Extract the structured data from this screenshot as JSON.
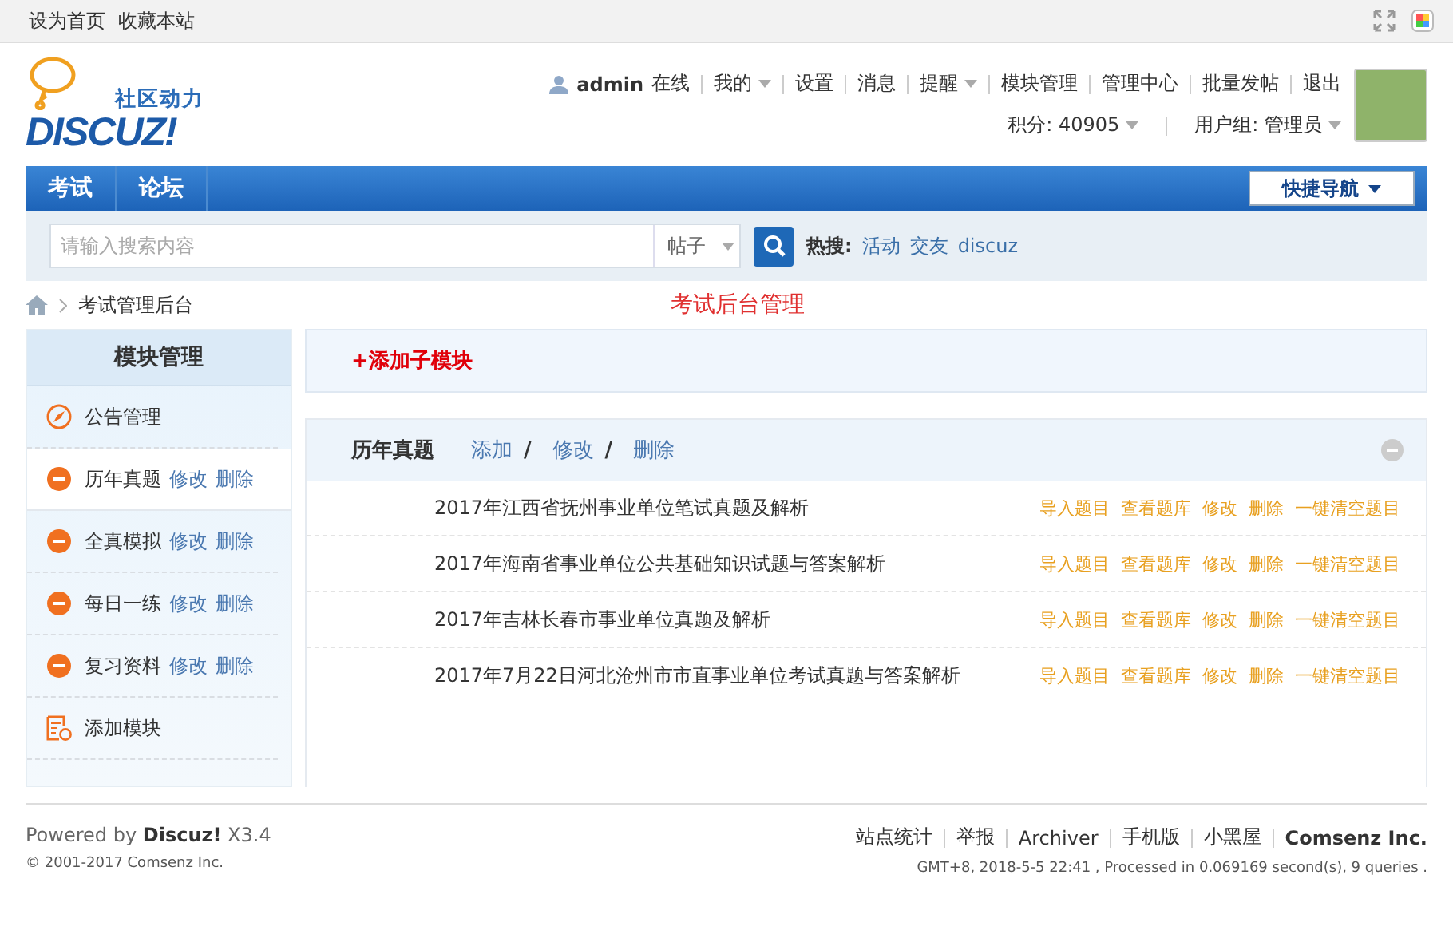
{
  "topbar": {
    "links": [
      "设为首页",
      "收藏本站"
    ]
  },
  "header": {
    "logo_tagline": "社区动力",
    "logo_text": "DISCUZ!",
    "user": {
      "name": "admin",
      "status": "在线"
    },
    "menu": [
      {
        "label": "我的",
        "dropdown": true
      },
      {
        "label": "设置",
        "dropdown": false
      },
      {
        "label": "消息",
        "dropdown": false
      },
      {
        "label": "提醒",
        "dropdown": true
      },
      {
        "label": "模块管理",
        "dropdown": false
      },
      {
        "label": "管理中心",
        "dropdown": false
      },
      {
        "label": "批量发帖",
        "dropdown": false
      },
      {
        "label": "退出",
        "dropdown": false
      }
    ],
    "stats": [
      {
        "label": "积分: 40905",
        "dropdown": true
      },
      {
        "label": "用户组: 管理员",
        "dropdown": true
      }
    ]
  },
  "nav": {
    "tabs": [
      {
        "label": "考试",
        "selected": false
      },
      {
        "label": "论坛",
        "selected": false
      }
    ],
    "quick_nav": "快捷导航"
  },
  "search": {
    "placeholder": "请输入搜索内容",
    "type": "帖子",
    "hot_label": "热搜:",
    "hot": [
      "活动",
      "交友",
      "discuz"
    ]
  },
  "breadcrumb": [
    "考试管理后台"
  ],
  "page_title": "考试后台管理",
  "sidebar": {
    "title": "模块管理",
    "items": [
      {
        "kind": "notice",
        "label": "公告管理",
        "selected": false
      },
      {
        "kind": "module",
        "label": "历年真题",
        "selected": true,
        "actions": [
          "修改",
          "删除"
        ]
      },
      {
        "kind": "module",
        "label": "全真模拟",
        "selected": false,
        "actions": [
          "修改",
          "删除"
        ]
      },
      {
        "kind": "module",
        "label": "每日一练",
        "selected": false,
        "actions": [
          "修改",
          "删除"
        ]
      },
      {
        "kind": "module",
        "label": "复习资料",
        "selected": false,
        "actions": [
          "修改",
          "删除"
        ]
      },
      {
        "kind": "add",
        "label": "添加模块",
        "selected": false
      }
    ]
  },
  "content": {
    "add_button": "+添加子模块",
    "section": {
      "title": "历年真题",
      "actions": [
        {
          "label": "添加",
          "separator": "/"
        },
        {
          "label": "修改",
          "separator": "/"
        },
        {
          "label": "删除"
        }
      ],
      "rows": [
        {
          "title": "2017年江西省抚州事业单位笔试真题及解析",
          "actions": [
            "导入题目",
            "查看题库",
            "修改",
            "删除",
            "一键清空题目"
          ]
        },
        {
          "title": "2017年海南省事业单位公共基础知识试题与答案解析",
          "actions": [
            "导入题目",
            "查看题库",
            "修改",
            "删除",
            "一键清空题目"
          ]
        },
        {
          "title": "2017年吉林长春市事业单位真题及解析",
          "actions": [
            "导入题目",
            "查看题库",
            "修改",
            "删除",
            "一键清空题目"
          ]
        },
        {
          "title": "2017年7月22日河北沧州市市直事业单位考试真题与答案解析",
          "actions": [
            "导入题目",
            "查看题库",
            "修改",
            "删除",
            "一键清空题目"
          ]
        }
      ]
    }
  },
  "footer": {
    "powered": "Powered by **Discuz!** X3.4",
    "copyright": "© 2001-2017 Comsenz Inc.",
    "links": [
      {
        "label": "站点统计",
        "kind": "link"
      },
      {
        "label": "举报",
        "kind": "link"
      },
      {
        "label": "Archiver",
        "kind": "link"
      },
      {
        "label": "手机版",
        "kind": "link"
      },
      {
        "label": "小黑屋",
        "kind": "link"
      },
      {
        "label": "Comsenz Inc.",
        "kind": "brand"
      }
    ],
    "stats": "GMT+8, 2018-5-5 22:41 , Processed in 0.069169 second(s), 9 queries ."
  }
}
